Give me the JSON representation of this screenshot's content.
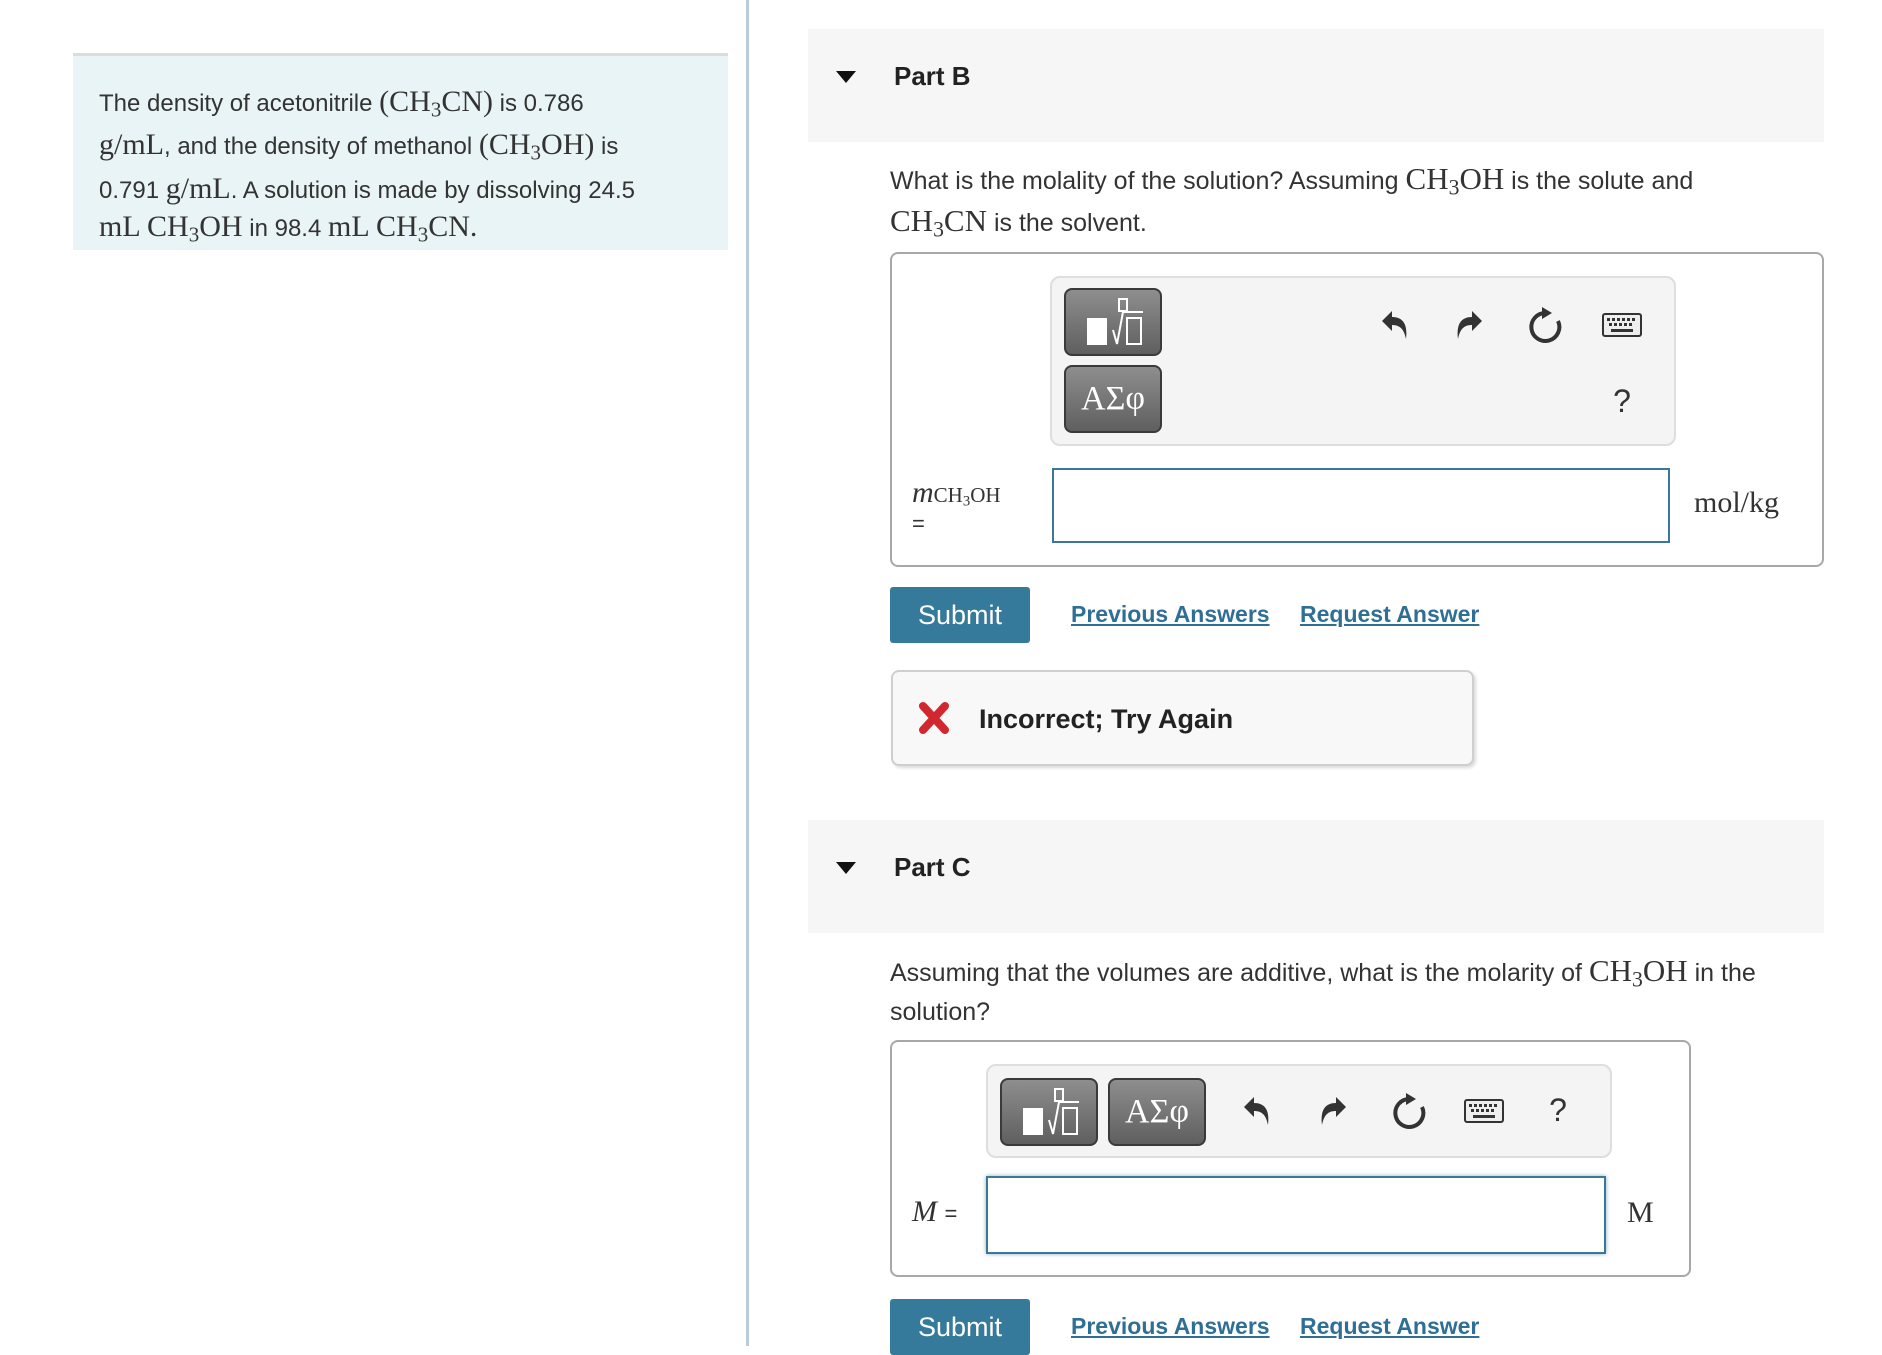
{
  "problem": {
    "t1": "The density of acetonitrile ",
    "f1": "(CH",
    "f1_sub": "3",
    "f1_end": "CN)",
    "t2": " is 0.786",
    "u1": "g/mL",
    "t3": ", and the density of methanol ",
    "f2": "(CH",
    "f2_sub": "3",
    "f2_end": "OH)",
    "t4": " is",
    "t5": "0.791 ",
    "u2": "g/mL",
    "t6": ". A solution is made by dissolving 24.5",
    "u3": "mL CH",
    "u3_sub": "3",
    "u3_end": "OH",
    "t7": " in 98.4 ",
    "u4": "mL CH",
    "u4_sub": "3",
    "u4_end": "CN."
  },
  "partB": {
    "title": "Part B",
    "q1": "What is the molality of the solution? Assuming ",
    "q_f1": "CH",
    "q_f1_sub": "3",
    "q_f1_end": "OH",
    "q2": " is the solute and",
    "q_f2": "CH",
    "q_f2_sub": "3",
    "q_f2_end": "CN",
    "q3": " is the solvent.",
    "var_main": "m",
    "var_sub_a": "CH",
    "var_sub_b": "3",
    "var_sub_c": "OH",
    "var_eq": "=",
    "input_value": "",
    "unit": "mol/kg",
    "templates_icon": "templates-icon",
    "greek_label": "ΑΣφ",
    "help_label": "?",
    "submit_label": "Submit",
    "previous_answers": "Previous Answers",
    "request_answer": "Request Answer",
    "feedback": "Incorrect; Try Again"
  },
  "partC": {
    "title": "Part C",
    "q1": "Assuming that the volumes are additive, what is the molarity of ",
    "q_f1": "CH",
    "q_f1_sub": "3",
    "q_f1_end": "OH",
    "q2": " in the",
    "q3": "solution?",
    "var_label": "M",
    "var_eq": "=",
    "input_value": "",
    "unit": "M",
    "greek_label": "ΑΣφ",
    "help_label": "?",
    "submit_label": "Submit",
    "previous_answers": "Previous Answers",
    "request_answer": "Request Answer"
  },
  "colors": {
    "accent": "#357a9a",
    "link": "#2f6f95",
    "error": "#d0282e",
    "problem_bg": "#e9f4f7"
  }
}
